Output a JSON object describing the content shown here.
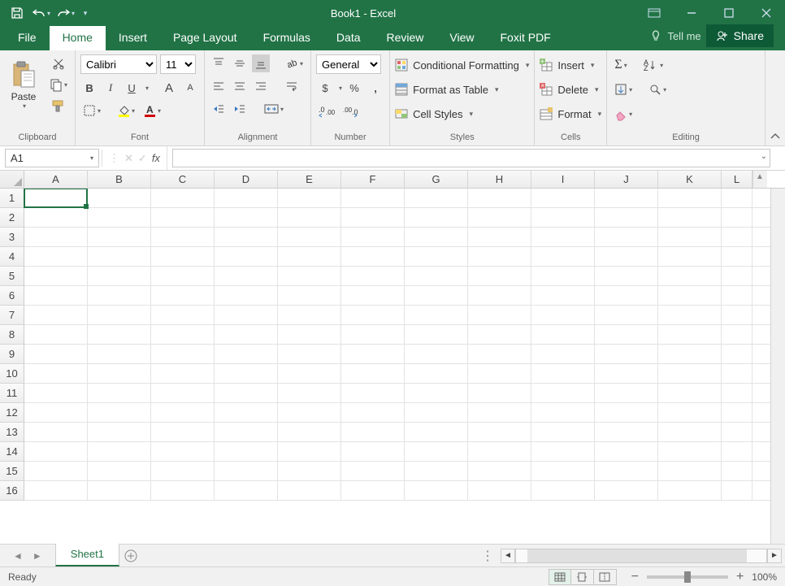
{
  "title": "Book1  -  Excel",
  "qat": {
    "save": "save",
    "undo": "undo",
    "redo": "redo"
  },
  "tabs": {
    "file": "File",
    "home": "Home",
    "insert": "Insert",
    "pagelayout": "Page Layout",
    "formulas": "Formulas",
    "data": "Data",
    "review": "Review",
    "view": "View",
    "foxit": "Foxit PDF",
    "tellme": "Tell me",
    "share": "Share"
  },
  "ribbon": {
    "clipboard": {
      "label": "Clipboard",
      "paste": "Paste"
    },
    "font": {
      "label": "Font",
      "name": "Calibri",
      "size": "11",
      "bold": "B",
      "italic": "I",
      "underline": "U",
      "grow": "A",
      "shrink": "A"
    },
    "alignment": {
      "label": "Alignment"
    },
    "number": {
      "label": "Number",
      "format": "General",
      "currency": "$",
      "percent": "%",
      "comma": ","
    },
    "styles": {
      "label": "Styles",
      "conditional": "Conditional Formatting",
      "table": "Format as Table",
      "cell": "Cell Styles"
    },
    "cells": {
      "label": "Cells",
      "insert": "Insert",
      "delete": "Delete",
      "format": "Format"
    },
    "editing": {
      "label": "Editing"
    }
  },
  "formula": {
    "name_box": "A1",
    "fx": "fx"
  },
  "grid": {
    "columns": [
      "A",
      "B",
      "C",
      "D",
      "E",
      "F",
      "G",
      "H",
      "I",
      "J",
      "K",
      "L"
    ],
    "rows": [
      "1",
      "2",
      "3",
      "4",
      "5",
      "6",
      "7",
      "8",
      "9",
      "10",
      "11",
      "12",
      "13",
      "14",
      "15",
      "16"
    ]
  },
  "sheet": {
    "name": "Sheet1",
    "new": "+"
  },
  "status": {
    "ready": "Ready",
    "zoom": "100%"
  }
}
